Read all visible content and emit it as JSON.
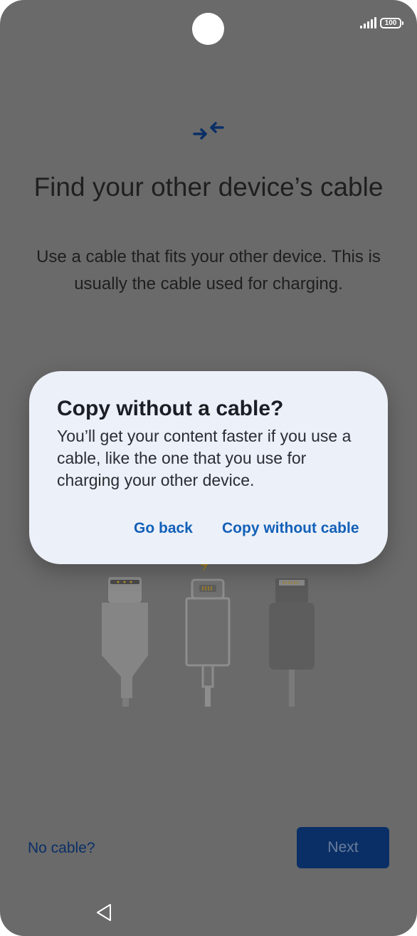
{
  "status_bar": {
    "battery_level": "100",
    "signal_icon": "signal-bars-icon"
  },
  "screen": {
    "header_icon": "transfer-arrows-icon",
    "title": "Find your other device’s cable",
    "description": "Use a cable that fits your other device. This is usually the cable used for charging.",
    "illustration": "cable-types-illustration",
    "no_cable_link": "No cable?",
    "next_button": "Next"
  },
  "dialog": {
    "title": "Copy without a cable?",
    "body": "You’ll get your content faster if you use a cable, like the one that you use for charging your other device.",
    "go_back_button": "Go back",
    "copy_without_cable_button": "Copy without cable"
  },
  "nav_bar": {
    "back_icon": "back-triangle-icon"
  },
  "colors": {
    "scrim_background": "#6a6a6a",
    "dialog_background": "#ecf0f8",
    "dialog_button_text": "#1260b8",
    "primary_dark": "#0a2f66"
  }
}
